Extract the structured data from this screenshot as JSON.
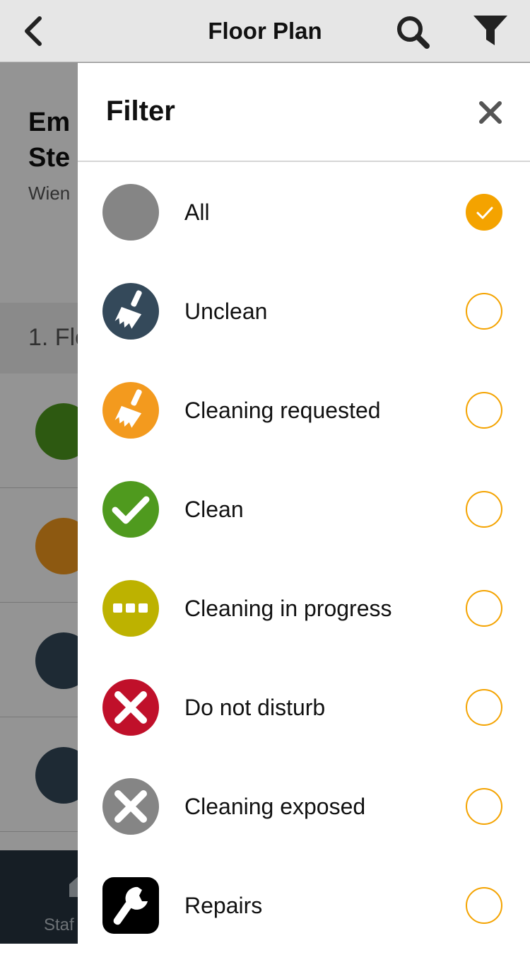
{
  "nav": {
    "title": "Floor Plan",
    "icons": [
      "chevron-left-icon",
      "search-icon",
      "filter-icon"
    ]
  },
  "background": {
    "title_line1": "Em",
    "title_line2": "Ste",
    "subtitle": "Wien",
    "floor_label": "1. Flo",
    "tab_label": "Staf"
  },
  "filter": {
    "title": "Filter",
    "close_icon": "close-icon",
    "accent_color": "#f4a300",
    "items": [
      {
        "label": "All",
        "icon": "gray-dot-icon",
        "color": "#858585",
        "checked": true
      },
      {
        "label": "Unclean",
        "icon": "broom-icon",
        "color": "#34495a",
        "checked": false
      },
      {
        "label": "Cleaning requested",
        "icon": "broom-icon",
        "color": "#f39a1e",
        "checked": false
      },
      {
        "label": "Clean",
        "icon": "checkmark-icon",
        "color": "#4f9a1e",
        "checked": false
      },
      {
        "label": "Cleaning in progress",
        "icon": "ellipsis-icon",
        "color": "#bdb200",
        "checked": false
      },
      {
        "label": "Do not disturb",
        "icon": "x-icon",
        "color": "#c0102a",
        "checked": false
      },
      {
        "label": "Cleaning exposed",
        "icon": "x-icon",
        "color": "#858585",
        "checked": false
      },
      {
        "label": "Repairs",
        "icon": "wrench-icon",
        "color": "#000000",
        "checked": false
      }
    ]
  }
}
